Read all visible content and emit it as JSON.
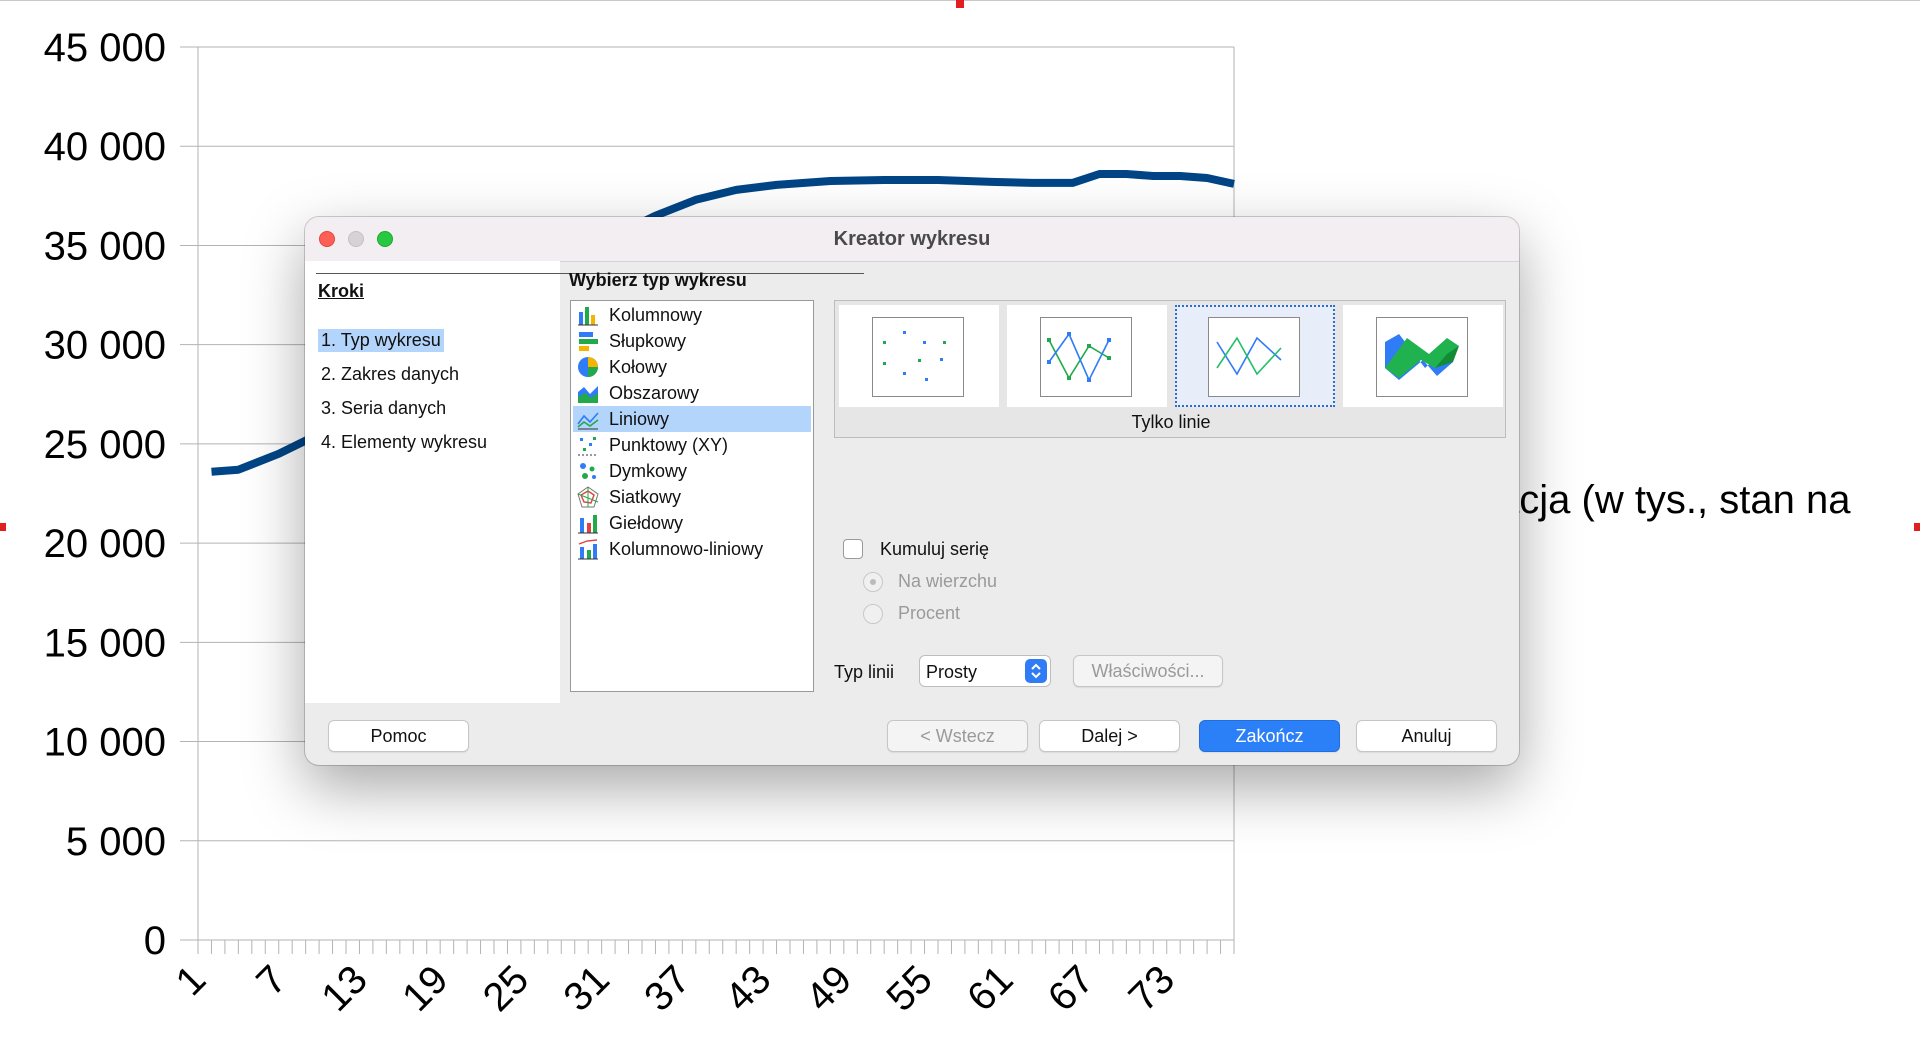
{
  "chart_data": {
    "type": "line",
    "y_ticks": [
      "45 000",
      "40 000",
      "35 000",
      "30 000",
      "25 000",
      "20 000",
      "15 000",
      "10 000",
      "5 000",
      "0"
    ],
    "x_ticks": [
      "1",
      "7",
      "13",
      "19",
      "25",
      "31",
      "37",
      "43",
      "49",
      "55",
      "61",
      "67",
      "73"
    ],
    "ylim": [
      0,
      45000
    ],
    "x_count": 78,
    "series": [
      {
        "color": "#004586",
        "x": [
          2,
          4,
          7,
          10,
          13,
          17,
          20,
          24,
          28,
          32,
          35,
          38,
          41,
          44,
          48,
          52,
          56,
          60,
          63,
          66,
          68,
          70,
          72,
          74,
          76,
          78
        ],
        "values": [
          23600,
          23700,
          24500,
          25500,
          26500,
          28000,
          29500,
          31000,
          33000,
          35500,
          36500,
          37300,
          37800,
          38050,
          38250,
          38300,
          38300,
          38200,
          38150,
          38150,
          38600,
          38600,
          38500,
          38500,
          38400,
          38100
        ]
      }
    ],
    "legend_fragment_1": "acja (w tys., stan na",
    "legend_fragment_2": ")"
  },
  "dialog": {
    "title": "Kreator wykresu",
    "steps_heading": "Kroki",
    "steps": [
      "1. Typ wykresu",
      "2. Zakres danych",
      "3. Seria danych",
      "4. Elementy wykresu"
    ],
    "type_heading": "Wybierz typ wykresu",
    "chart_types": [
      "Kolumnowy",
      "Słupkowy",
      "Kołowy",
      "Obszarowy",
      "Liniowy",
      "Punktowy (XY)",
      "Dymkowy",
      "Siatkowy",
      "Giełdowy",
      "Kolumnowo-liniowy"
    ],
    "selected_type_index": 4,
    "variant_label": "Tylko linie",
    "selected_variant_index": 2,
    "stack_label": "Kumuluj serię",
    "radio_on_top": "Na wierzchu",
    "radio_percent": "Procent",
    "line_type_label": "Typ linii",
    "line_type_value": "Prosty",
    "properties_button": "Właściwości...",
    "help_button": "Pomoc",
    "back_button": "< Wstecz",
    "next_button": "Dalej >",
    "finish_button": "Zakończ",
    "cancel_button": "Anuluj"
  },
  "colors": {
    "series_line": "#004586",
    "accent": "#2c80f7",
    "selection": "#b3d4fb"
  }
}
